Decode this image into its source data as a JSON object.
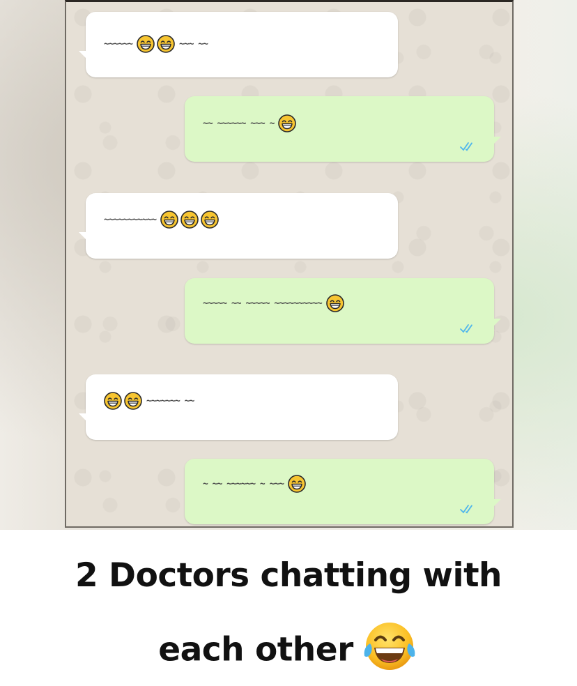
{
  "chat": {
    "messages": [
      {
        "direction": "incoming",
        "before": "~~~~~~",
        "emojis": 2,
        "after": "~~~ ~~",
        "status": ""
      },
      {
        "direction": "outgoing",
        "before": "~~ ~~~~~~ ~~~ ~",
        "emojis": 1,
        "after": "",
        "status": "read"
      },
      {
        "direction": "incoming",
        "before": "~~~~~~~~~~~",
        "emojis": 3,
        "after": "",
        "status": ""
      },
      {
        "direction": "outgoing",
        "before": "~~~~~ ~~ ~~~~~ ~~~~~~~~~~",
        "emojis": 1,
        "after": "",
        "status": "read"
      },
      {
        "direction": "incoming",
        "before": "",
        "emojis": 2,
        "after": "~~~~~~~ ~~",
        "status": ""
      },
      {
        "direction": "outgoing",
        "before": "~ ~~ ~~~~~~ ~ ~~~",
        "emojis": 1,
        "after": "",
        "status": "read"
      }
    ],
    "emoji_name": "face-with-tears-of-joy",
    "colors": {
      "incoming": "#ffffff",
      "outgoing": "#dcf8c6",
      "tick": "#4fb6ec",
      "wallpaper": "#e6e0d6"
    }
  },
  "caption": {
    "line1": "2 Doctors chatting with",
    "line2": "each other",
    "emoji": "face-with-tears-of-joy"
  }
}
